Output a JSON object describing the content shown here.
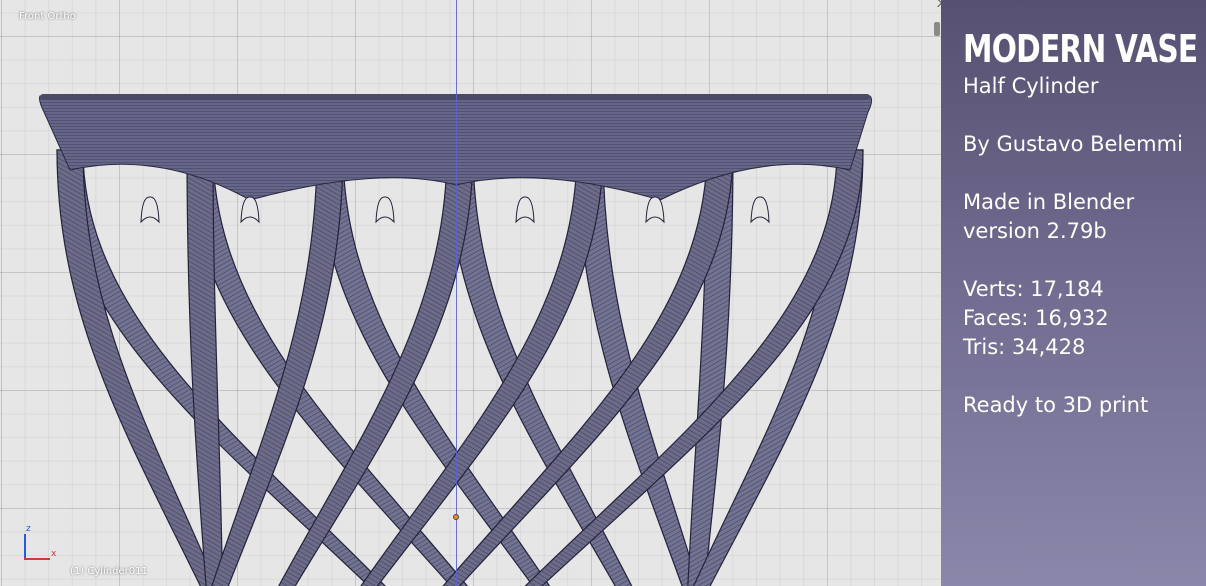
{
  "viewport": {
    "view_name": "Front Ortho",
    "active_object": "(1) Cylinder011",
    "gizmo": {
      "z_label": "z",
      "x_label": "x"
    },
    "colors": {
      "background": "#e6e6e6",
      "mesh": "#6c6c8a",
      "mesh_dark": "#3c3c56",
      "vertical_axis": "#5a64c8",
      "origin": "#f08a24"
    }
  },
  "info_panel": {
    "title": "MODERN VASE",
    "subtitle": "Half Cylinder",
    "author": "By Gustavo Belemmi",
    "made_in": "Made in Blender",
    "version": "version 2.79b",
    "verts": "Verts: 17,184",
    "faces": "Faces: 16,932",
    "tris": "Tris: 34,428",
    "print_ready": "Ready to 3D print"
  },
  "icons": [
    "axis-gizmo-icon",
    "object-origin-icon"
  ]
}
